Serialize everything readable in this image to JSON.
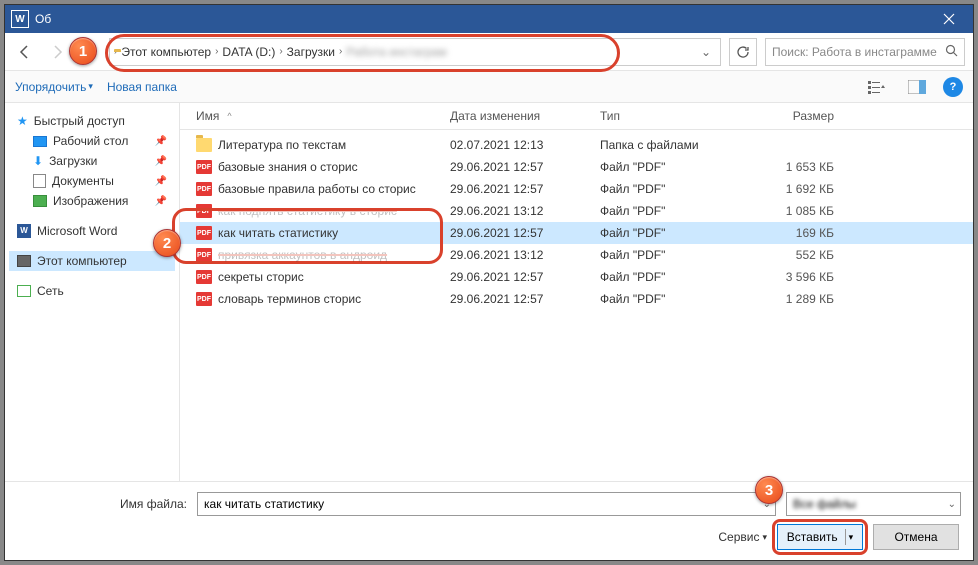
{
  "title": "Об",
  "nav": {
    "breadcrumb": [
      "Этот компьютер",
      "DATA (D:)",
      "Загрузки"
    ],
    "breadcrumb_blur": "Работа инстаграм"
  },
  "search": {
    "placeholder": "Поиск: Работа в инстаграмме"
  },
  "toolbar": {
    "organize": "Упорядочить",
    "new_folder": "Новая папка"
  },
  "sidebar": {
    "quick_access": "Быстрый доступ",
    "desktop": "Рабочий стол",
    "downloads": "Загрузки",
    "documents": "Документы",
    "images": "Изображения",
    "word": "Microsoft Word",
    "this_pc": "Этот компьютер",
    "network": "Сеть"
  },
  "columns": {
    "name": "Имя",
    "date": "Дата изменения",
    "type": "Тип",
    "size": "Размер"
  },
  "files": [
    {
      "icon": "folder",
      "name": "Литература  по текстам",
      "date": "02.07.2021 12:13",
      "type": "Папка с файлами",
      "size": ""
    },
    {
      "icon": "pdf",
      "name": "базовые знания о сторис",
      "date": "29.06.2021 12:57",
      "type": "Файл \"PDF\"",
      "size": "1 653 КБ"
    },
    {
      "icon": "pdf",
      "name": "базовые правила работы со сторис",
      "date": "29.06.2021 12:57",
      "type": "Файл \"PDF\"",
      "size": "1 692 КБ"
    },
    {
      "icon": "pdf",
      "name": "как поднять статистику в сторис",
      "date": "29.06.2021 13:12",
      "type": "Файл \"PDF\"",
      "size": "1 085 КБ",
      "strike": true
    },
    {
      "icon": "pdf",
      "name": "как читать статистику",
      "date": "29.06.2021 12:57",
      "type": "Файл \"PDF\"",
      "size": "169 КБ",
      "selected": true,
      "highlight": true
    },
    {
      "icon": "pdf",
      "name": "привязка аккаунтов в андроид",
      "date": "29.06.2021 13:12",
      "type": "Файл \"PDF\"",
      "size": "552 КБ",
      "strike": true
    },
    {
      "icon": "pdf",
      "name": "секреты сторис",
      "date": "29.06.2021 12:57",
      "type": "Файл \"PDF\"",
      "size": "3 596 КБ"
    },
    {
      "icon": "pdf",
      "name": "словарь терминов сторис",
      "date": "29.06.2021 12:57",
      "type": "Файл \"PDF\"",
      "size": "1 289 КБ"
    }
  ],
  "bottom": {
    "filename_label": "Имя файла:",
    "filename_value": "как читать статистику",
    "filter": "Все файлы",
    "service": "Сервис",
    "insert": "Вставить",
    "cancel": "Отмена"
  },
  "badges": {
    "b1": "1",
    "b2": "2",
    "b3": "3"
  }
}
